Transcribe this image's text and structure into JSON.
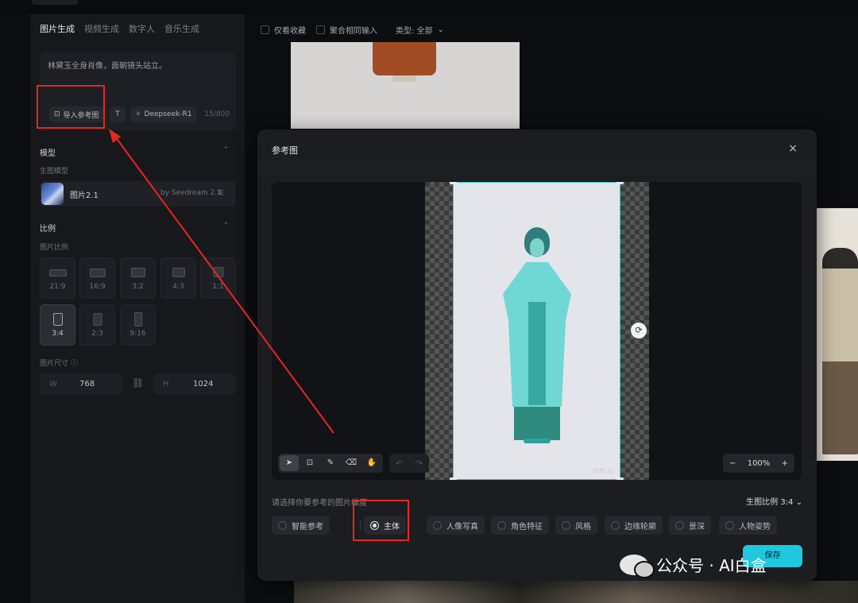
{
  "left_panel": {
    "tabs": [
      "图片生成",
      "视频生成",
      "数字人",
      "音乐生成"
    ],
    "prompt": {
      "text": "林黛玉全身肖像，面朝镜头站立。",
      "import_ref": "导入参考图",
      "text_tool": "T",
      "llm": "Deepseek-R1",
      "count": "15/800"
    },
    "model_section": {
      "title": "模型",
      "sub": "生图模型",
      "name": "图片2.1",
      "by": "by Seedream 2.1"
    },
    "ratio_section": {
      "title": "比例",
      "sub": "图片比例",
      "ratios": [
        "21:9",
        "16:9",
        "3:2",
        "4:3",
        "1:1",
        "3:4",
        "2:3",
        "9:16"
      ],
      "selected": "3:4"
    },
    "size_section": {
      "title": "图片尺寸",
      "w_key": "W",
      "w_val": "768",
      "h_key": "H",
      "h_val": "1024"
    }
  },
  "filters": {
    "fav": "仅看收藏",
    "aggregate": "聚合相同输入",
    "type": "类型: 全部"
  },
  "modal": {
    "title": "参考图",
    "close": "×",
    "watermark": "即梦 AI",
    "zoom": {
      "minus": "−",
      "value": "100%",
      "plus": "+"
    },
    "hint": "请选择你要参考的图片维度",
    "ratio": "生图比例 3:4",
    "options": [
      "智能参考",
      "主体",
      "人像写真",
      "角色特征",
      "风格",
      "边缘轮廓",
      "景深",
      "人物姿势"
    ],
    "selected_option": "主体",
    "save": "保存"
  },
  "watermark": {
    "text": "公众号 · AI白盒"
  },
  "colors": {
    "accent": "#1fc7df",
    "annotation": "#e8261e"
  }
}
